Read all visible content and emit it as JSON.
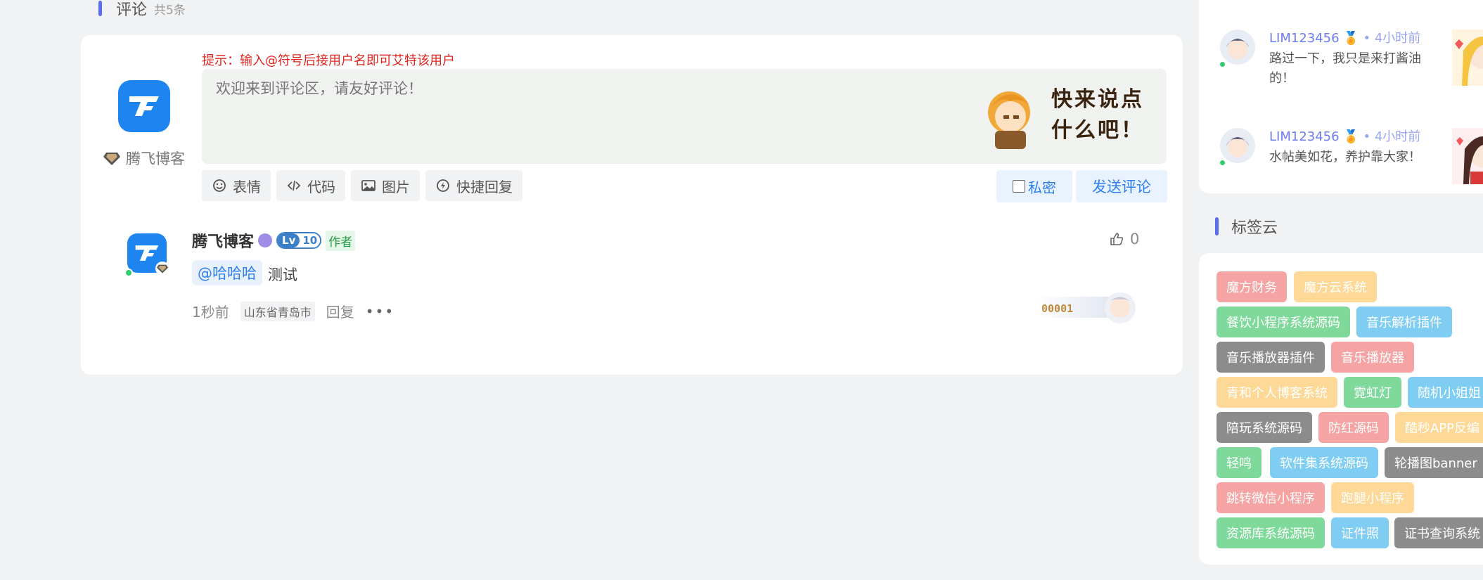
{
  "comments_header": {
    "title": "评论",
    "count": "共5条"
  },
  "editor": {
    "user_name": "腾飞博客",
    "hint": "提示：输入@符号后接用户名即可艾特该用户",
    "placeholder": "欢迎来到评论区，请友好评论！",
    "mascot_line1": "快来说点",
    "mascot_line2": "什么吧！",
    "tools": [
      {
        "label": "表情",
        "icon": "smile-icon"
      },
      {
        "label": "代码",
        "icon": "code-icon"
      },
      {
        "label": "图片",
        "icon": "image-icon"
      },
      {
        "label": "快捷回复",
        "icon": "quick-reply-icon"
      }
    ],
    "private_label": "私密",
    "send_label": "发送评论"
  },
  "comment": {
    "author": "腾飞博客",
    "level_a": "Lv",
    "level_b": "10",
    "author_tag": "作者",
    "likes": "0",
    "mention": "@哈哈哈",
    "text": "测试",
    "time": "1秒前",
    "location": "山东省青岛市",
    "reply": "回复",
    "more": "•••",
    "stamp_text": "00001"
  },
  "sidebar": {
    "messages": [
      {
        "user": "LIM123456",
        "time": "4小时前",
        "text": "路过一下，我只是来打酱油的！"
      },
      {
        "user": "LIM123456",
        "time": "4小时前",
        "text": "水帖美如花，养护靠大家！"
      }
    ],
    "tag_cloud_title": "标签云",
    "tags": [
      {
        "label": "魔方财务",
        "color": "#f5a3a3"
      },
      {
        "label": "魔方云系统",
        "color": "#fdd896"
      },
      {
        "label": "餐饮小程序系统源码",
        "color": "#7ed99a"
      },
      {
        "label": "音乐解析插件",
        "color": "#7fcdf2"
      },
      {
        "label": "音乐播放器插件",
        "color": "#8c8c8c"
      },
      {
        "label": "音乐播放器",
        "color": "#f5a3a3"
      },
      {
        "label": "青和个人博客系统",
        "color": "#fdd896"
      },
      {
        "label": "霓虹灯",
        "color": "#7ed99a"
      },
      {
        "label": "随机小姐姐",
        "color": "#7fcdf2"
      },
      {
        "label": "陪玩系统源码",
        "color": "#8c8c8c"
      },
      {
        "label": "防红源码",
        "color": "#f5a3a3"
      },
      {
        "label": "酷秒APP反编",
        "color": "#fdd896"
      },
      {
        "label": "轻鸣",
        "color": "#7ed99a"
      },
      {
        "label": "软件集系统源码",
        "color": "#7fcdf2"
      },
      {
        "label": "轮播图banner",
        "color": "#8c8c8c"
      },
      {
        "label": "跳转微信小程序",
        "color": "#f5a3a3"
      },
      {
        "label": "跑腿小程序",
        "color": "#fdd896"
      },
      {
        "label": "资源库系统源码",
        "color": "#7ed99a"
      },
      {
        "label": "证件照",
        "color": "#7fcdf2"
      },
      {
        "label": "证书查询系统",
        "color": "#8c8c8c"
      }
    ]
  }
}
